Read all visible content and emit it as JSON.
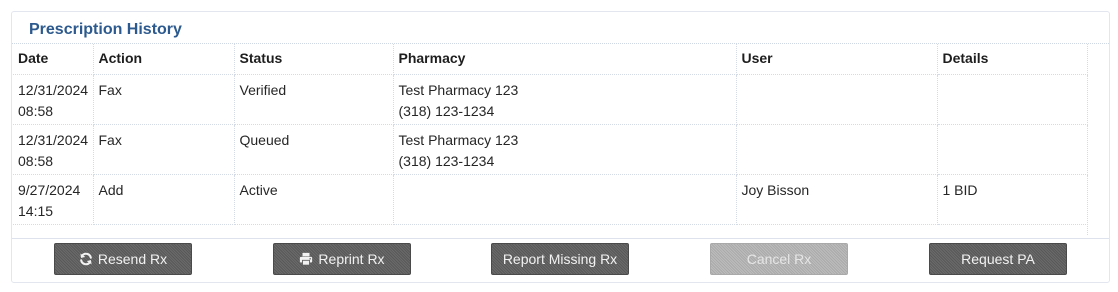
{
  "panel": {
    "title": "Prescription History"
  },
  "table": {
    "headers": [
      "Date",
      "Action",
      "Status",
      "Pharmacy",
      "User",
      "Details"
    ],
    "rows": [
      {
        "date": "12/31/2024",
        "time": "08:58",
        "action": "Fax",
        "status": "Verified",
        "pharmacy_name": "Test Pharmacy 123",
        "pharmacy_phone": "(318) 123-1234",
        "user": "",
        "details": ""
      },
      {
        "date": "12/31/2024",
        "time": "08:58",
        "action": "Fax",
        "status": "Queued",
        "pharmacy_name": "Test Pharmacy 123",
        "pharmacy_phone": "(318) 123-1234",
        "user": "",
        "details": ""
      },
      {
        "date": "9/27/2024",
        "time": "14:15",
        "action": "Add",
        "status": "Active",
        "pharmacy_name": "",
        "pharmacy_phone": "",
        "user": "Joy Bisson",
        "details": "1 BID"
      }
    ]
  },
  "buttons": {
    "resend": {
      "label": "Resend Rx",
      "icon": "refresh-icon"
    },
    "reprint": {
      "label": "Reprint Rx",
      "icon": "print-icon"
    },
    "report_missing": {
      "label": "Report Missing Rx"
    },
    "cancel": {
      "label": "Cancel Rx",
      "disabled": true
    },
    "request_pa": {
      "label": "Request PA"
    }
  }
}
